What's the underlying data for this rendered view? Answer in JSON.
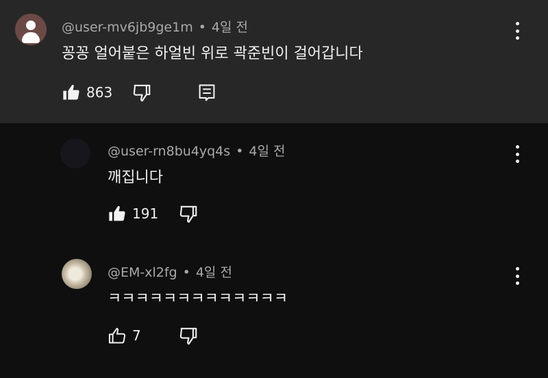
{
  "main_comment": {
    "author": "@user-mv6jb9ge1m",
    "time": "4일 전",
    "text": "꽁꽁 얼어붙은 하얼빈 위로 곽준빈이 걸어갑니다",
    "likes": "863"
  },
  "replies": [
    {
      "author": "@user-rn8bu4yq4s",
      "time": "4일 전",
      "text": "깨집니다",
      "likes": "191"
    },
    {
      "author": "@EM-xl2fg",
      "time": "4일 전",
      "text": "ㅋㅋㅋㅋㅋㅋㅋㅋㅋㅋㅋㅋㅋ",
      "likes": "7"
    }
  ],
  "separator": "•",
  "icons": {
    "like_filled": "thumbs-up-filled-icon",
    "like_outline": "thumbs-up-outline-icon",
    "dislike": "thumbs-down-icon",
    "reply": "reply-icon",
    "menu": "more-vert-icon"
  },
  "colors": {
    "background": "#0f0f0f",
    "highlighted_comment_bg": "#272727",
    "text": "#f1f1f1",
    "meta_text": "#aaaaaa"
  }
}
